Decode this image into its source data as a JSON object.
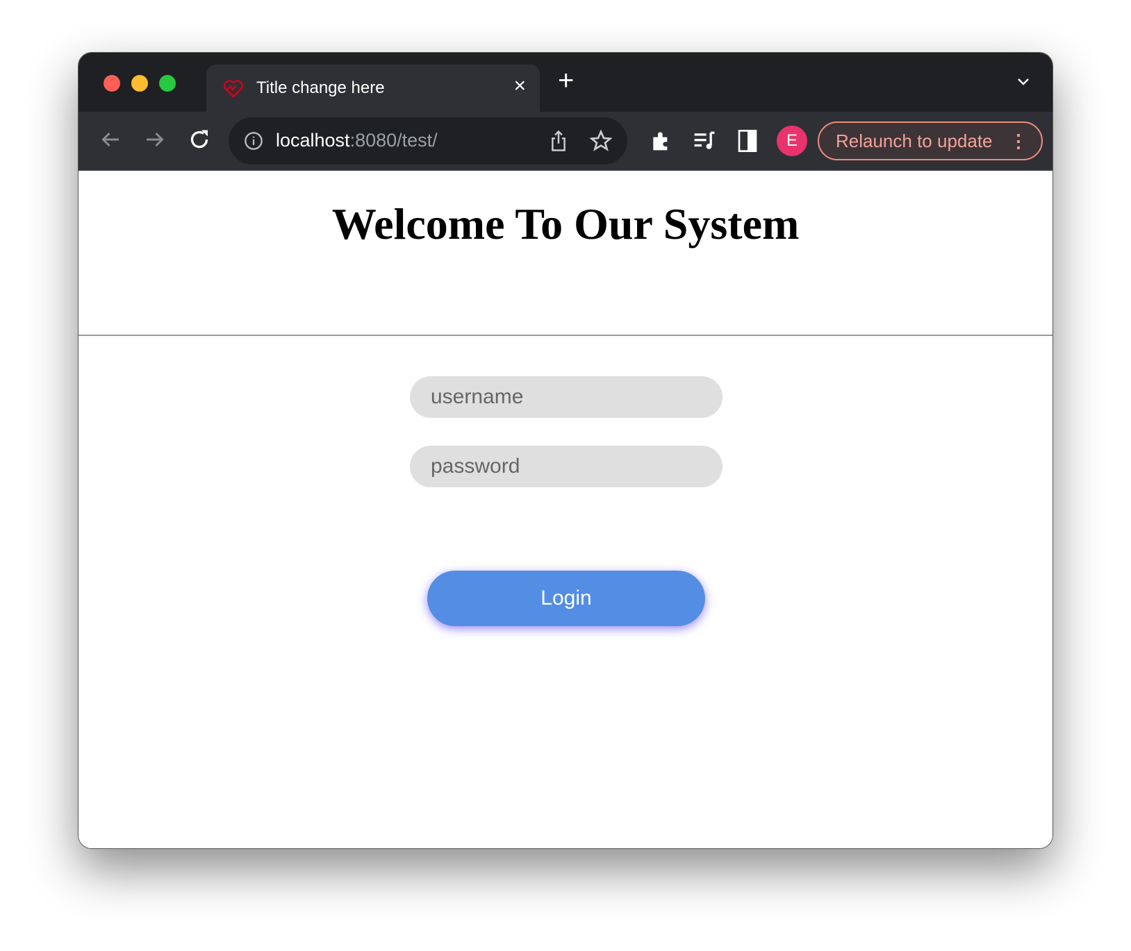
{
  "browser": {
    "tab": {
      "title": "Title change here",
      "favicon": "heart-pulse-icon",
      "close": "×"
    },
    "new_tab": "+",
    "url": {
      "host": "localhost",
      "rest": ":8080/test/"
    },
    "profile_initial": "E",
    "relaunch_label": "Relaunch to update",
    "menu": "⋮",
    "colors": {
      "traffic_red": "#ff5f57",
      "traffic_yellow": "#febc2e",
      "traffic_green": "#28c840",
      "profile": "#e8336d",
      "relaunch": "#f28b82"
    }
  },
  "page": {
    "heading": "Welcome To Our System",
    "username_placeholder": "username",
    "password_placeholder": "password",
    "login_label": "Login",
    "accent": "#548de4"
  }
}
